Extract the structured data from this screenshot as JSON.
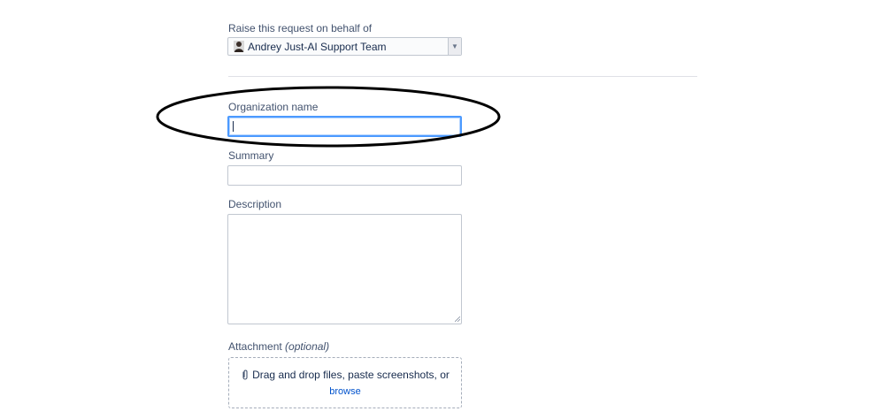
{
  "on_behalf": {
    "label": "Raise this request on behalf of",
    "selected_value": "Andrey Just-AI Support Team",
    "arrow": "▼"
  },
  "organization": {
    "label": "Organization name",
    "value": ""
  },
  "summary": {
    "label": "Summary",
    "value": ""
  },
  "description": {
    "label": "Description",
    "value": ""
  },
  "attachment": {
    "label": "Attachment",
    "optional_label": "(optional)",
    "drop_text": "Drag and drop files, paste screenshots, or",
    "browse_link": "browse",
    "icon": "paperclip-icon"
  },
  "colors": {
    "focus_border": "#4c9aff",
    "link": "#0052cc",
    "annotation_ellipse": "#000000"
  }
}
